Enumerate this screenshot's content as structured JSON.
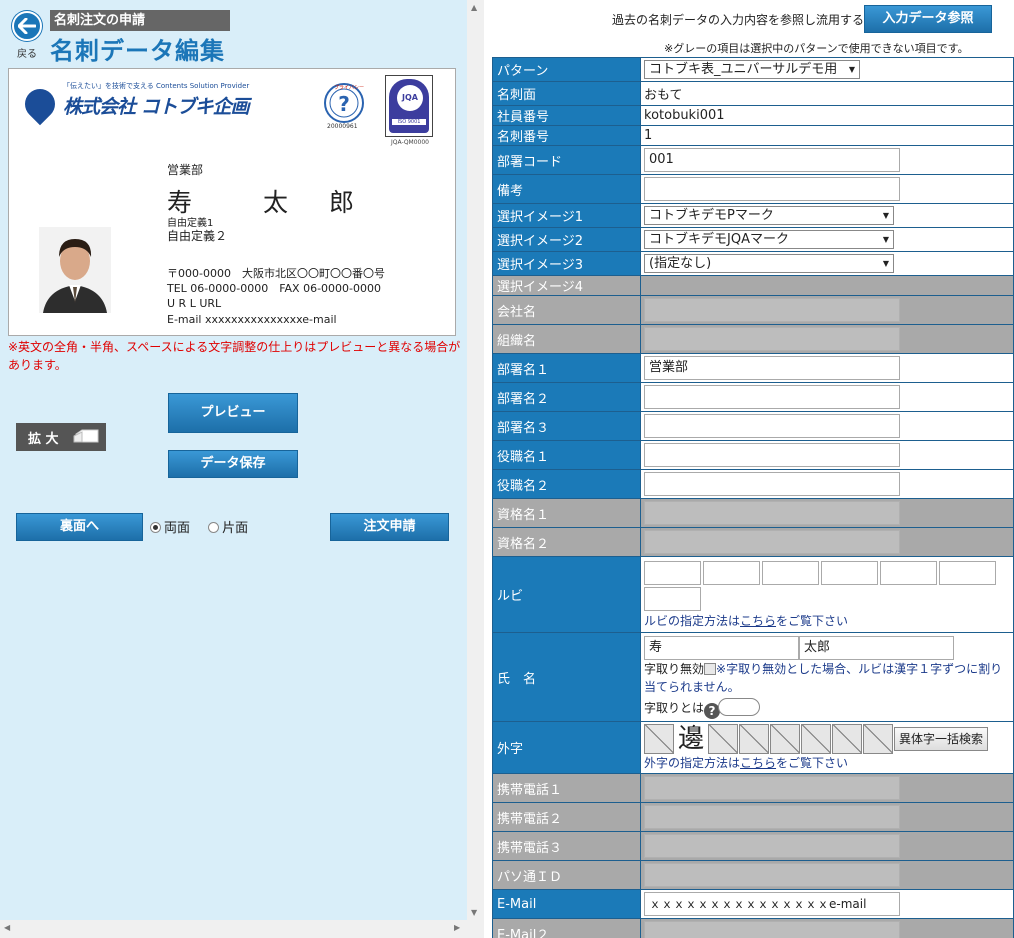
{
  "header": {
    "back_label": "戻る",
    "subtitle": "名刺注文の申請",
    "title": "名刺データ編集"
  },
  "card": {
    "tagline": "「伝えたい」を技術で支える Contents Solution Provider",
    "company": "株式会社 コトブキ企画",
    "privacy_number": "20000961",
    "jqa_label": "JQA",
    "jqa_code": "JQA-QM0000",
    "department": "営業部",
    "name_chars": [
      "寿",
      "太",
      "郎"
    ],
    "free1": "自由定義1",
    "free2": "自由定義２",
    "address": "〒000-0000　大阪市北区〇〇町〇〇番〇号",
    "tel": "TEL 06-0000-0000　FAX 06-0000-0000",
    "url": "U R L URL",
    "email": "E-mail xxxxxxxxxxxxxxxe-mail"
  },
  "notice": "※英文の全角・半角、スペースによる文字調整の仕上りはプレビューと異なる場合があります。",
  "buttons": {
    "zoom": "拡 大",
    "preview": "プレビュー",
    "save": "データ保存",
    "back_side": "裏面へ",
    "order": "注文申請",
    "reference": "入力データ参照"
  },
  "sides": {
    "double": "両面",
    "single": "片面",
    "selected": "double"
  },
  "right_header": {
    "reference_text": "過去の名刺データの入力内容を参照し流用する",
    "gray_note": "※グレーの項目は選択中のパターンで使用できない項目です。"
  },
  "form": {
    "pattern": {
      "label": "パターン",
      "value": "コトブキ表_ユニバーサルデモ用"
    },
    "card_side": {
      "label": "名刺面",
      "value": "おもて"
    },
    "employee_no": {
      "label": "社員番号",
      "value": "kotobuki001"
    },
    "card_no": {
      "label": "名刺番号",
      "value": "1"
    },
    "dept_code": {
      "label": "部署コード",
      "value": "001"
    },
    "remarks": {
      "label": "備考",
      "value": ""
    },
    "image1": {
      "label": "選択イメージ1",
      "value": "コトブキデモPマーク"
    },
    "image2": {
      "label": "選択イメージ2",
      "value": "コトブキデモJQAマーク"
    },
    "image3": {
      "label": "選択イメージ3",
      "value": "(指定なし)"
    },
    "image4": {
      "label": "選択イメージ4"
    },
    "company_name": {
      "label": "会社名",
      "value": ""
    },
    "org_name": {
      "label": "組織名",
      "value": ""
    },
    "dept1": {
      "label": "部署名１",
      "value": "営業部"
    },
    "dept2": {
      "label": "部署名２",
      "value": ""
    },
    "dept3": {
      "label": "部署名３",
      "value": ""
    },
    "title1": {
      "label": "役職名１",
      "value": ""
    },
    "title2": {
      "label": "役職名２",
      "value": ""
    },
    "qual1": {
      "label": "資格名１",
      "value": ""
    },
    "qual2": {
      "label": "資格名２",
      "value": ""
    },
    "ruby": {
      "label": "ルビ",
      "note_prefix": "ルビの指定方法は",
      "note_link": "こちら",
      "note_suffix": "をご覧下さい"
    },
    "name": {
      "label": "氏　名",
      "surname": "寿",
      "given": "太郎",
      "disable_label": "字取り無効",
      "disable_note": "※字取り無効とした場合、ルビは漢字１字ずつに割り当てられません。",
      "jitori_label": "字取りとは",
      "help_icon": "?"
    },
    "gaiji": {
      "label": "外字",
      "char": "邊",
      "search_btn": "異体字一括検索",
      "note_prefix": "外字の指定方法は",
      "note_link": "こちら",
      "note_suffix": "をご覧下さい"
    },
    "mobile1": {
      "label": "携帯電話１",
      "value": ""
    },
    "mobile2": {
      "label": "携帯電話２",
      "value": ""
    },
    "mobile3": {
      "label": "携帯電話３",
      "value": ""
    },
    "pc_id": {
      "label": "パソ通ＩＤ",
      "value": ""
    },
    "email": {
      "label": "E-Mail",
      "value": "ｘｘｘｘｘｘｘｘｘｘｘｘｘｘｘe-mail"
    },
    "email2": {
      "label": "E-Mail２",
      "value": ""
    }
  },
  "colors": {
    "accent": "#1b76b8",
    "label_blue": "#1b7ab8",
    "disabled_gray": "#a9a9a9",
    "left_bg": "#d9eef9",
    "notice_red": "#e00000"
  }
}
